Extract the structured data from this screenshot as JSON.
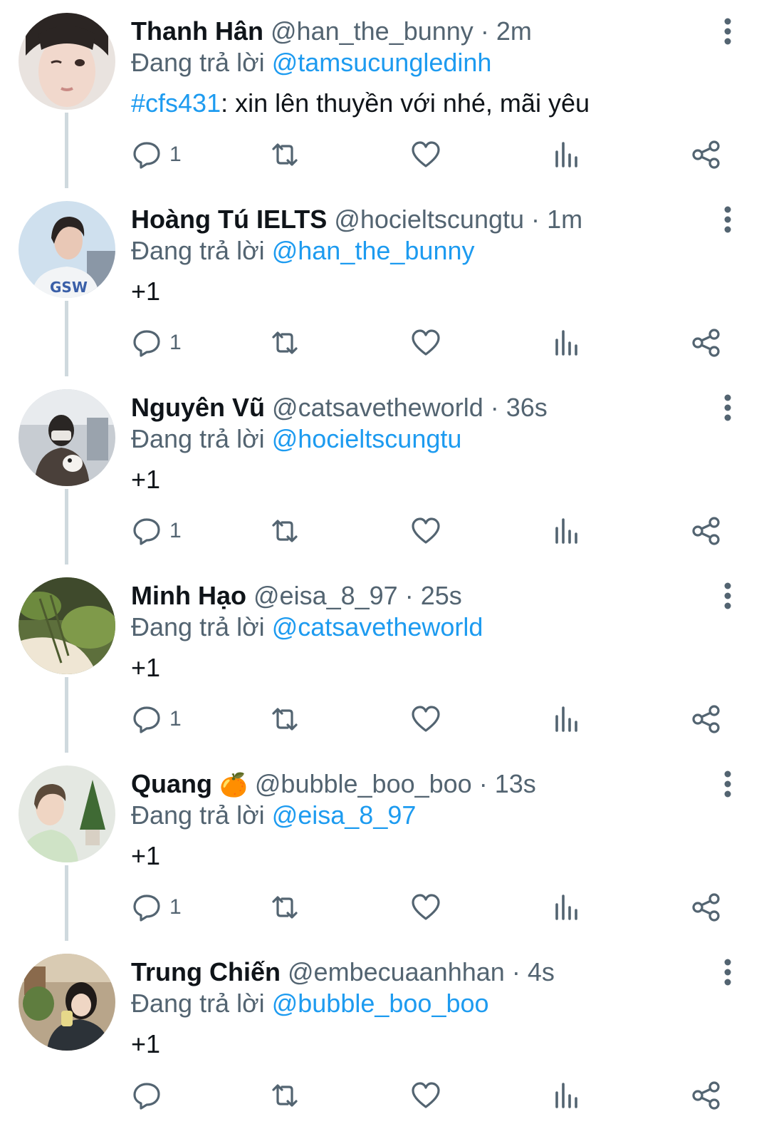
{
  "reply_prefix": "Đang trả lời",
  "colors": {
    "accent": "#1d9bf0",
    "muted": "#536471",
    "text": "#0f1419",
    "thread_line": "#cfd9de"
  },
  "icons": {
    "more": "more-vertical-icon",
    "reply": "reply-bubble-icon",
    "retweet": "retweet-icon",
    "like": "heart-icon",
    "views": "analytics-bars-icon",
    "share": "share-icon"
  },
  "tweets": [
    {
      "name": "Thanh Hân",
      "emoji": "",
      "handle": "@han_the_bunny",
      "time": "2m",
      "reply_to": "@tamsucungledinh",
      "hashtag": "#cfs431",
      "text": ": xin lên thuyền với nhé, mãi yêu",
      "reply_count": "1"
    },
    {
      "name": "Hoàng Tú IELTS",
      "emoji": "",
      "handle": "@hocieltscungtu",
      "time": "1m",
      "reply_to": "@han_the_bunny",
      "hashtag": "",
      "text": "+1",
      "reply_count": "1"
    },
    {
      "name": "Nguyên Vũ",
      "emoji": "",
      "handle": "@catsavetheworld",
      "time": "36s",
      "reply_to": "@hocieltscungtu",
      "hashtag": "",
      "text": "+1",
      "reply_count": "1"
    },
    {
      "name": "Minh Hạo",
      "emoji": "",
      "handle": "@eisa_8_97",
      "time": "25s",
      "reply_to": "@catsavetheworld",
      "hashtag": "",
      "text": "+1",
      "reply_count": "1"
    },
    {
      "name": "Quang",
      "emoji": "🍊",
      "handle": "@bubble_boo_boo",
      "time": "13s",
      "reply_to": "@eisa_8_97",
      "hashtag": "",
      "text": "+1",
      "reply_count": "1"
    },
    {
      "name": "Trung Chiến",
      "emoji": "",
      "handle": "@embecuaanhhan",
      "time": "4s",
      "reply_to": "@bubble_boo_boo",
      "hashtag": "",
      "text": "+1",
      "reply_count": ""
    }
  ]
}
